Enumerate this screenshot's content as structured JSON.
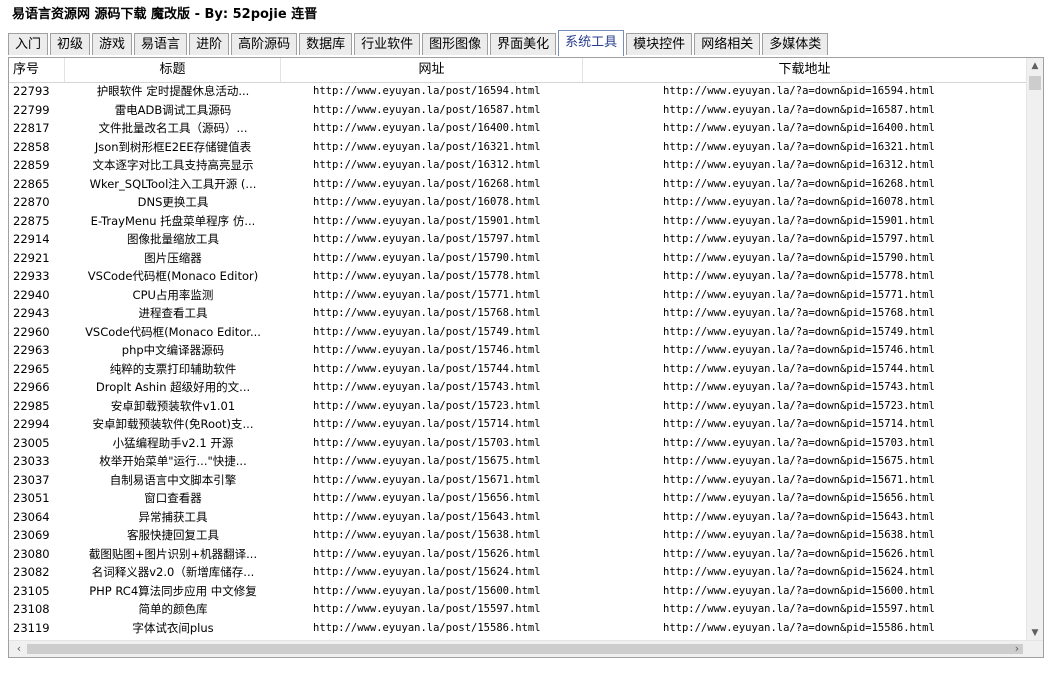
{
  "window": {
    "title": "易语言资源网 源码下载 魔改版 - By: 52pojie 连晋"
  },
  "tabs": [
    {
      "label": "入门"
    },
    {
      "label": "初级"
    },
    {
      "label": "游戏"
    },
    {
      "label": "易语言"
    },
    {
      "label": "进阶"
    },
    {
      "label": "高阶源码"
    },
    {
      "label": "数据库"
    },
    {
      "label": "行业软件"
    },
    {
      "label": "图形图像"
    },
    {
      "label": "界面美化"
    },
    {
      "label": "系统工具"
    },
    {
      "label": "模块控件"
    },
    {
      "label": "网络相关"
    },
    {
      "label": "多媒体类"
    }
  ],
  "active_tab": "系统工具",
  "table": {
    "columns": [
      "序号",
      "标题",
      "网址",
      "下载地址"
    ],
    "rows": [
      {
        "id": "22793",
        "title": "护眼软件 定时提醒休息活动...",
        "url": "http://www.eyuyan.la/post/16594.html",
        "download": "http://www.eyuyan.la/?a=down&pid=16594.html"
      },
      {
        "id": "22799",
        "title": "雷电ADB调试工具源码",
        "url": "http://www.eyuyan.la/post/16587.html",
        "download": "http://www.eyuyan.la/?a=down&pid=16587.html"
      },
      {
        "id": "22817",
        "title": "文件批量改名工具（源码）...",
        "url": "http://www.eyuyan.la/post/16400.html",
        "download": "http://www.eyuyan.la/?a=down&pid=16400.html"
      },
      {
        "id": "22858",
        "title": "Json到树形框E2EE存储键值表",
        "url": "http://www.eyuyan.la/post/16321.html",
        "download": "http://www.eyuyan.la/?a=down&pid=16321.html"
      },
      {
        "id": "22859",
        "title": "文本逐字对比工具支持高亮显示",
        "url": "http://www.eyuyan.la/post/16312.html",
        "download": "http://www.eyuyan.la/?a=down&pid=16312.html"
      },
      {
        "id": "22865",
        "title": "Wker_SQLTool注入工具开源 (...",
        "url": "http://www.eyuyan.la/post/16268.html",
        "download": "http://www.eyuyan.la/?a=down&pid=16268.html"
      },
      {
        "id": "22870",
        "title": "DNS更换工具",
        "url": "http://www.eyuyan.la/post/16078.html",
        "download": "http://www.eyuyan.la/?a=down&pid=16078.html"
      },
      {
        "id": "22875",
        "title": "E-TrayMenu 托盘菜单程序 仿...",
        "url": "http://www.eyuyan.la/post/15901.html",
        "download": "http://www.eyuyan.la/?a=down&pid=15901.html"
      },
      {
        "id": "22914",
        "title": "图像批量缩放工具",
        "url": "http://www.eyuyan.la/post/15797.html",
        "download": "http://www.eyuyan.la/?a=down&pid=15797.html"
      },
      {
        "id": "22921",
        "title": "图片压缩器",
        "url": "http://www.eyuyan.la/post/15790.html",
        "download": "http://www.eyuyan.la/?a=down&pid=15790.html"
      },
      {
        "id": "22933",
        "title": "VSCode代码框(Monaco Editor)",
        "url": "http://www.eyuyan.la/post/15778.html",
        "download": "http://www.eyuyan.la/?a=down&pid=15778.html"
      },
      {
        "id": "22940",
        "title": "CPU占用率监测",
        "url": "http://www.eyuyan.la/post/15771.html",
        "download": "http://www.eyuyan.la/?a=down&pid=15771.html"
      },
      {
        "id": "22943",
        "title": "进程查看工具",
        "url": "http://www.eyuyan.la/post/15768.html",
        "download": "http://www.eyuyan.la/?a=down&pid=15768.html"
      },
      {
        "id": "22960",
        "title": "VSCode代码框(Monaco Editor...",
        "url": "http://www.eyuyan.la/post/15749.html",
        "download": "http://www.eyuyan.la/?a=down&pid=15749.html"
      },
      {
        "id": "22963",
        "title": "php中文编译器源码",
        "url": "http://www.eyuyan.la/post/15746.html",
        "download": "http://www.eyuyan.la/?a=down&pid=15746.html"
      },
      {
        "id": "22965",
        "title": "纯粹的支票打印辅助软件",
        "url": "http://www.eyuyan.la/post/15744.html",
        "download": "http://www.eyuyan.la/?a=down&pid=15744.html"
      },
      {
        "id": "22966",
        "title": "Droplt Ashin 超级好用的文...",
        "url": "http://www.eyuyan.la/post/15743.html",
        "download": "http://www.eyuyan.la/?a=down&pid=15743.html"
      },
      {
        "id": "22985",
        "title": "安卓卸载预装软件v1.01",
        "url": "http://www.eyuyan.la/post/15723.html",
        "download": "http://www.eyuyan.la/?a=down&pid=15723.html"
      },
      {
        "id": "22994",
        "title": "安卓卸载预装软件(免Root)支...",
        "url": "http://www.eyuyan.la/post/15714.html",
        "download": "http://www.eyuyan.la/?a=down&pid=15714.html"
      },
      {
        "id": "23005",
        "title": "小猛编程助手v2.1 开源",
        "url": "http://www.eyuyan.la/post/15703.html",
        "download": "http://www.eyuyan.la/?a=down&pid=15703.html"
      },
      {
        "id": "23033",
        "title": "枚举开始菜单\"运行...\"快捷...",
        "url": "http://www.eyuyan.la/post/15675.html",
        "download": "http://www.eyuyan.la/?a=down&pid=15675.html"
      },
      {
        "id": "23037",
        "title": "自制易语言中文脚本引擎",
        "url": "http://www.eyuyan.la/post/15671.html",
        "download": "http://www.eyuyan.la/?a=down&pid=15671.html"
      },
      {
        "id": "23051",
        "title": "窗口查看器",
        "url": "http://www.eyuyan.la/post/15656.html",
        "download": "http://www.eyuyan.la/?a=down&pid=15656.html"
      },
      {
        "id": "23064",
        "title": "异常捕获工具",
        "url": "http://www.eyuyan.la/post/15643.html",
        "download": "http://www.eyuyan.la/?a=down&pid=15643.html"
      },
      {
        "id": "23069",
        "title": "客服快捷回复工具",
        "url": "http://www.eyuyan.la/post/15638.html",
        "download": "http://www.eyuyan.la/?a=down&pid=15638.html"
      },
      {
        "id": "23080",
        "title": "截图贴图+图片识别+机器翻译...",
        "url": "http://www.eyuyan.la/post/15626.html",
        "download": "http://www.eyuyan.la/?a=down&pid=15626.html"
      },
      {
        "id": "23082",
        "title": "名词释义器v2.0（新增库储存...",
        "url": "http://www.eyuyan.la/post/15624.html",
        "download": "http://www.eyuyan.la/?a=down&pid=15624.html"
      },
      {
        "id": "23105",
        "title": "PHP RC4算法同步应用 中文修复",
        "url": "http://www.eyuyan.la/post/15600.html",
        "download": "http://www.eyuyan.la/?a=down&pid=15600.html"
      },
      {
        "id": "23108",
        "title": "简单的颜色库",
        "url": "http://www.eyuyan.la/post/15597.html",
        "download": "http://www.eyuyan.la/?a=down&pid=15597.html"
      },
      {
        "id": "23119",
        "title": "字体试衣间plus",
        "url": "http://www.eyuyan.la/post/15586.html",
        "download": "http://www.eyuyan.la/?a=down&pid=15586.html"
      }
    ]
  },
  "icons": {
    "scroll_up": "▲",
    "scroll_down": "▼",
    "scroll_left": "‹",
    "scroll_right": "›"
  },
  "colors": {
    "active_tab_text": "#2a3f8f"
  }
}
